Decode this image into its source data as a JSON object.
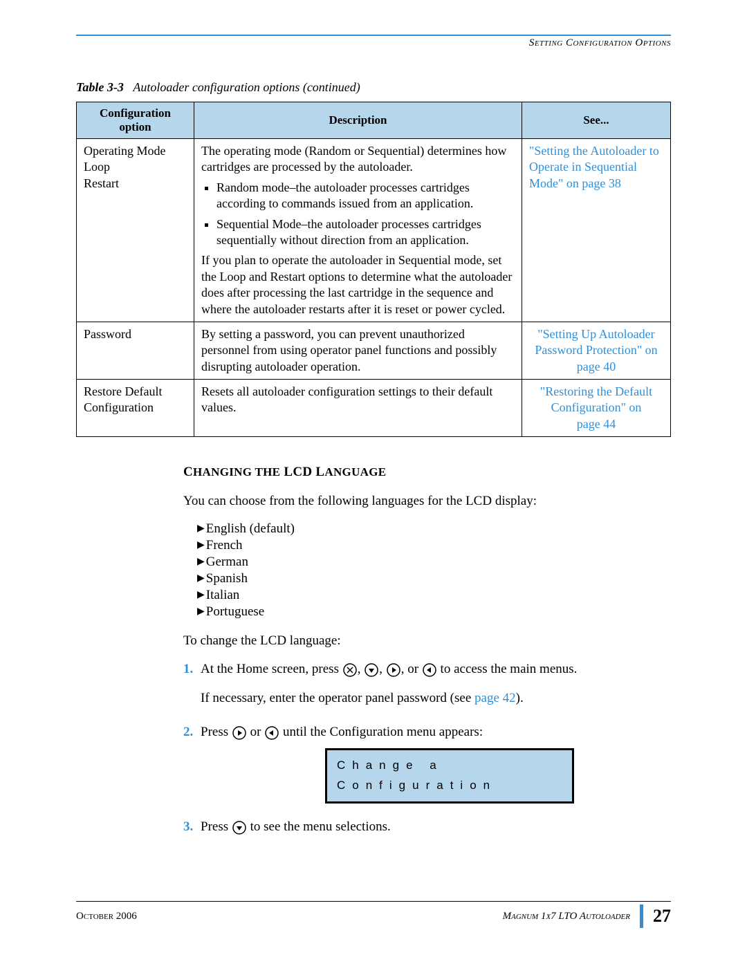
{
  "header": {
    "section_title": "Setting Configuration Options"
  },
  "table": {
    "caption_label": "Table 3-3",
    "caption_text": "Autoloader configuration options  (continued)",
    "head": {
      "col1": "Configuration option",
      "col2": "Description",
      "col3": "See..."
    },
    "rows": [
      {
        "option_l1": "Operating Mode",
        "option_l2": "Loop",
        "option_l3": "Restart",
        "desc_intro": "The operating mode (Random or Sequential) determines how cartridges are processed by the autoloader.",
        "desc_b1": "Random mode–the autoloader processes cartridges according to commands issued from an application.",
        "desc_b2": "Sequential Mode–the autoloader processes cartridges sequentially without direction from an application.",
        "desc_outro": "If you plan to operate the autoloader in Sequential mode, set the Loop and Restart options to determine what the autoloader does after processing the last cartridge in the sequence and where the autoloader restarts after it is reset or power cycled.",
        "see": "\"Setting the Autoloader to Operate in Sequential Mode\" on page 38"
      },
      {
        "option": "Password",
        "desc": "By setting a password, you can prevent unauthorized personnel from using operator panel functions and possibly disrupting autoloader operation.",
        "see_l1": "\"Setting Up Autoloader Password Protection\" on",
        "see_l2": "page 40"
      },
      {
        "option_l1": "Restore Default",
        "option_l2": "Configuration",
        "desc": "Resets all autoloader configuration settings to their default values.",
        "see_l1": "\"Restoring the Default Configuration\" on",
        "see_l2": "page 44"
      }
    ]
  },
  "section": {
    "heading_1": "C",
    "heading_2": "hanging the",
    "heading_3": "LCD L",
    "heading_4": "anguage",
    "intro": "You can choose from the following languages for the LCD display:",
    "langs": [
      "English (default)",
      "French",
      "German",
      "Spanish",
      "Italian",
      "Portuguese"
    ],
    "lead": "To change the LCD language:",
    "step1_a": "At the Home screen, press ",
    "step1_b": ", ",
    "step1_c": ", ",
    "step1_d": ", or ",
    "step1_e": " to access the main menus.",
    "step1_sub_a": "If necessary, enter the operator panel password (see ",
    "step1_sub_link": "page 42",
    "step1_sub_b": ").",
    "step2_a": "Press ",
    "step2_b": " or ",
    "step2_c": " until the Configuration menu appears:",
    "lcd_line1": "Change a",
    "lcd_line2": "Configuration",
    "step3_a": "Press ",
    "step3_b": " to see the menu selections."
  },
  "footer": {
    "date": "October 2006",
    "product": "Magnum 1x7 LTO Autoloader",
    "page": "27"
  }
}
